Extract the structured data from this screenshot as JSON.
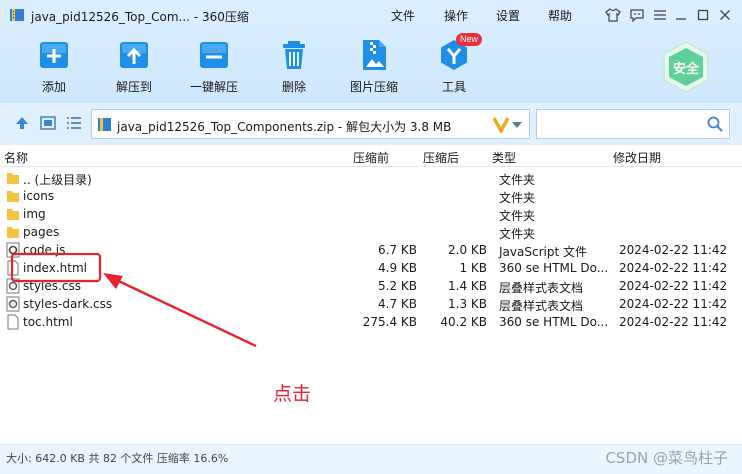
{
  "window": {
    "title": "java_pid12526_Top_Com... - 360压缩",
    "menu": [
      "文件",
      "操作",
      "设置",
      "帮助"
    ]
  },
  "toolbar": {
    "items": [
      {
        "label": "添加",
        "icon": "add-archive-icon"
      },
      {
        "label": "解压到",
        "icon": "extract-to-icon"
      },
      {
        "label": "一键解压",
        "icon": "one-click-extract-icon"
      },
      {
        "label": "删除",
        "icon": "trash-icon"
      },
      {
        "label": "图片压缩",
        "icon": "image-compress-icon"
      },
      {
        "label": "工具",
        "icon": "tools-icon"
      }
    ],
    "new_badge": "New",
    "safe_label": "安全"
  },
  "address": {
    "path": "java_pid12526_Top_Components.zip - 解包大小为 3.8 MB"
  },
  "columns": {
    "name": "名称",
    "compressed_before": "压缩前",
    "compressed_after": "压缩后",
    "type": "类型",
    "modified": "修改日期"
  },
  "files": [
    {
      "name": ".. (上级目录)",
      "before": "",
      "after": "",
      "type": "文件夹",
      "date": "",
      "icon": "folder"
    },
    {
      "name": "icons",
      "before": "",
      "after": "",
      "type": "文件夹",
      "date": "",
      "icon": "folder"
    },
    {
      "name": "img",
      "before": "",
      "after": "",
      "type": "文件夹",
      "date": "",
      "icon": "folder"
    },
    {
      "name": "pages",
      "before": "",
      "after": "",
      "type": "文件夹",
      "date": "",
      "icon": "folder"
    },
    {
      "name": "code.js",
      "before": "6.7 KB",
      "after": "2.0 KB",
      "type": "JavaScript 文件",
      "date": "2024-02-22 11:42",
      "icon": "js"
    },
    {
      "name": "index.html",
      "before": "4.9 KB",
      "after": "1 KB",
      "type": "360 se HTML Do...",
      "date": "2024-02-22 11:42",
      "icon": "doc"
    },
    {
      "name": "styles.css",
      "before": "5.2 KB",
      "after": "1.4 KB",
      "type": "层叠样式表文档",
      "date": "2024-02-22 11:42",
      "icon": "css"
    },
    {
      "name": "styles-dark.css",
      "before": "4.7 KB",
      "after": "1.3 KB",
      "type": "层叠样式表文档",
      "date": "2024-02-22 11:42",
      "icon": "css"
    },
    {
      "name": "toc.html",
      "before": "275.4 KB",
      "after": "40.2 KB",
      "type": "360 se HTML Do...",
      "date": "2024-02-22 11:42",
      "icon": "doc"
    }
  ],
  "annotation": {
    "label": "点击",
    "color": "#e8232f"
  },
  "status": {
    "text": "大小: 642.0 KB 共 82 个文件 压缩率 16.6%",
    "watermark": "CSDN @菜鸟柱子"
  },
  "colors": {
    "accent": "#1e8fe6",
    "header_bg": "#d4eafd",
    "folder": "#f5c342",
    "safe": "#5fd09a"
  }
}
